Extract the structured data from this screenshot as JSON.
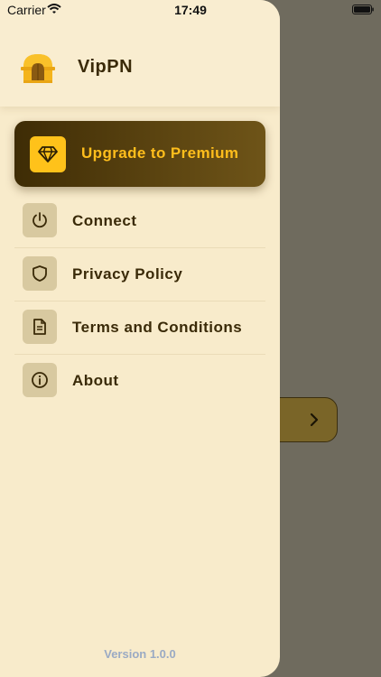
{
  "status_bar": {
    "carrier": "Carrier",
    "time": "17:49"
  },
  "drawer": {
    "app_name": "VipPN",
    "premium": {
      "label": "Upgrade to Premium",
      "icon": "diamond-icon"
    },
    "menu": [
      {
        "label": "Connect",
        "icon": "power-icon"
      },
      {
        "label": "Privacy Policy",
        "icon": "shield-icon"
      },
      {
        "label": "Terms and Conditions",
        "icon": "document-icon"
      },
      {
        "label": "About",
        "icon": "info-icon"
      }
    ],
    "version": "Version 1.0.0"
  },
  "colors": {
    "drawer_bg": "#f8ebcb",
    "accent": "#ffc21a",
    "premium_bg": "#4a360a",
    "text": "#3a2a08",
    "version_text": "#9aaac4",
    "overlay": "#6f6b5e"
  }
}
